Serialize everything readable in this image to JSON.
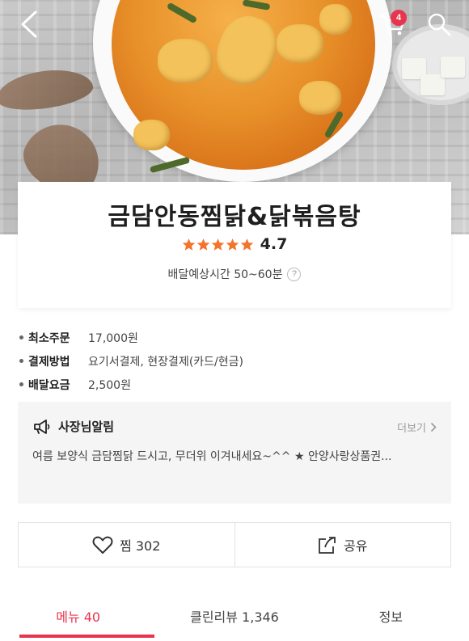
{
  "header": {
    "cart_count": "4",
    "colors": {
      "badge": "#e8344e",
      "accent": "#e8344e",
      "star": "#f4742b"
    }
  },
  "store": {
    "name": "금담안동찜닭&닭볶음탕",
    "rating": "4.7",
    "rating_stars": 5,
    "eta": "배달예상시간 50~60분",
    "help_symbol": "?"
  },
  "details": [
    {
      "label": "최소주문",
      "value": "17,000원"
    },
    {
      "label": "결제방법",
      "value": "요기서결제, 현장결제(카드/현금)"
    },
    {
      "label": "배달요금",
      "value": "2,500원"
    }
  ],
  "notice": {
    "title": "사장님알림",
    "more_label": "더보기",
    "text": "여름 보양식 금담찜닭 드시고, 무더위 이겨내세요~^^ ★ 안양사랑상품권..."
  },
  "actions": {
    "favorite_label": "찜 302",
    "share_label": "공유"
  },
  "tabs": [
    {
      "label": "메뉴 40",
      "active": true
    },
    {
      "label": "클린리뷰 1,346",
      "active": false
    },
    {
      "label": "정보",
      "active": false
    }
  ],
  "icons": [
    "back-icon",
    "cart-icon",
    "search-icon",
    "star-icon",
    "help-icon",
    "megaphone-icon",
    "chevron-right-icon",
    "heart-icon",
    "share-icon"
  ]
}
